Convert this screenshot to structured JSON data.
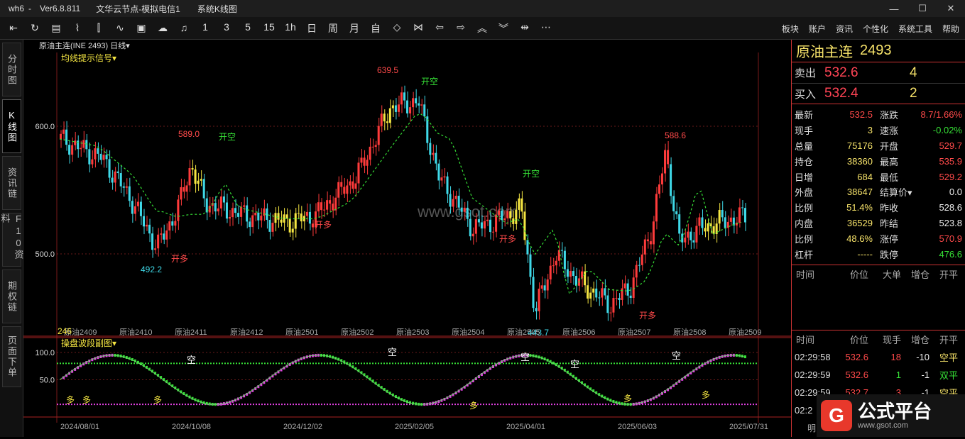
{
  "window": {
    "title": "wh6",
    "version": "Ver6.8.811",
    "server": "文华云节点-模拟电信1",
    "view": "系统K线图"
  },
  "toolbar": {
    "icons": [
      "left-arrow-icon",
      "refresh-icon",
      "table-icon",
      "line-chart-icon",
      "bar-chart-icon",
      "indicator-icon",
      "screen-icon",
      "cloud-icon",
      "bell-icon"
    ],
    "periods": [
      "1",
      "3",
      "5",
      "15",
      "1h",
      "日",
      "周",
      "月",
      "自"
    ],
    "nav_icons": [
      "expand-icon",
      "collapse-icon",
      "prev-icon",
      "next-icon",
      "up-icon",
      "down-icon",
      "split-icon",
      "more-icon"
    ],
    "menu": [
      "板块",
      "账户",
      "资讯",
      "个性化",
      "系统工具",
      "帮助"
    ]
  },
  "sidebar": {
    "tabs": [
      "分时图",
      "K线图",
      "资讯链",
      "F10资料",
      "期权链",
      "页面下单"
    ],
    "active": 1
  },
  "chart": {
    "symbol_label": "原油主连(INE 2493)",
    "period": "日线",
    "indicator_main": "均线提示信号",
    "indicator_sub": "操盘波段副图",
    "watermark": "www.gsot.com",
    "price_ticks": [
      "600.0",
      "500.0"
    ],
    "sub_ticks": [
      "100.0",
      "50.0"
    ],
    "date_ticks": [
      "2024/08/01",
      "2024/10/08",
      "2024/12/02",
      "2025/02/05",
      "2025/04/01",
      "2025/06/03",
      "2025/07/31"
    ],
    "contracts": [
      "原油2409",
      "原油2410",
      "原油2411",
      "原油2412",
      "原油2501",
      "原油2502",
      "原油2503",
      "原油2504",
      "原油2505",
      "原油2506",
      "原油2507",
      "原油2508",
      "原油2509"
    ],
    "volume_label": "246",
    "annotations": {
      "high1": "589.0",
      "low1": "492.2",
      "high2": "639.5",
      "low2": "443.7",
      "high3": "588.6"
    },
    "signals": {
      "kaikong": "开空",
      "kaiduo": "开多",
      "duo": "多",
      "kong": "空"
    },
    "colors": {
      "up": "#ff3b3b",
      "down": "#3fd9e8",
      "signal": "#f5e642",
      "ma": "#36e036",
      "sub_pink": "#e040e0",
      "sub_green": "#36e036"
    }
  },
  "quote": {
    "name": "原油主连",
    "code": "2493",
    "sell_label": "卖出",
    "sell_price": "532.6",
    "sell_qty": "4",
    "buy_label": "买入",
    "buy_price": "532.4",
    "buy_qty": "2",
    "rows": [
      {
        "l1": "最新",
        "v1": "532.5",
        "c1": "red",
        "l2": "涨跌",
        "v2": "8.7/1.66%",
        "c2": "red"
      },
      {
        "l1": "现手",
        "v1": "3",
        "c1": "yellow",
        "l2": "速涨",
        "v2": "-0.02%",
        "c2": "green"
      },
      {
        "l1": "总量",
        "v1": "75176",
        "c1": "yellow",
        "l2": "开盘",
        "v2": "529.7",
        "c2": "red"
      },
      {
        "l1": "持仓",
        "v1": "38360",
        "c1": "yellow",
        "l2": "最高",
        "v2": "535.9",
        "c2": "red"
      },
      {
        "l1": "日增",
        "v1": "684",
        "c1": "yellow",
        "l2": "最低",
        "v2": "529.2",
        "c2": "red"
      },
      {
        "l1": "外盘",
        "v1": "38647",
        "c1": "yellow",
        "l2": "结算价▾",
        "v2": "0.0",
        "c2": "white"
      },
      {
        "l1": "比例",
        "v1": "51.4%",
        "c1": "yellow",
        "l2": "昨收",
        "v2": "528.6",
        "c2": "white"
      },
      {
        "l1": "内盘",
        "v1": "36529",
        "c1": "yellow",
        "l2": "昨结",
        "v2": "523.8",
        "c2": "white"
      },
      {
        "l1": "比例",
        "v1": "48.6%",
        "c1": "yellow",
        "l2": "涨停",
        "v2": "570.9",
        "c2": "red"
      },
      {
        "l1": "杠杆",
        "v1": "-----",
        "c1": "yellow",
        "l2": "跌停",
        "v2": "476.6",
        "c2": "green"
      }
    ],
    "orders_header": [
      "时间",
      "价位",
      "大单",
      "增仓",
      "开平"
    ],
    "ticks_header": [
      "时间",
      "价位",
      "现手",
      "增仓",
      "开平"
    ],
    "ticks": [
      {
        "time": "02:29:58",
        "price": "532.6",
        "qty": "18",
        "oi": "-10",
        "type": "空平"
      },
      {
        "time": "02:29:59",
        "price": "532.6",
        "qty": "1",
        "oi": "-1",
        "type": "双平"
      },
      {
        "time": "02:29:59",
        "price": "532.7",
        "qty": "3",
        "oi": "-1",
        "type": "空平"
      }
    ],
    "partial_time": "02:2",
    "bottom_tab": "明"
  },
  "logo": {
    "name": "公式平台",
    "url": "www.gsot.com"
  }
}
